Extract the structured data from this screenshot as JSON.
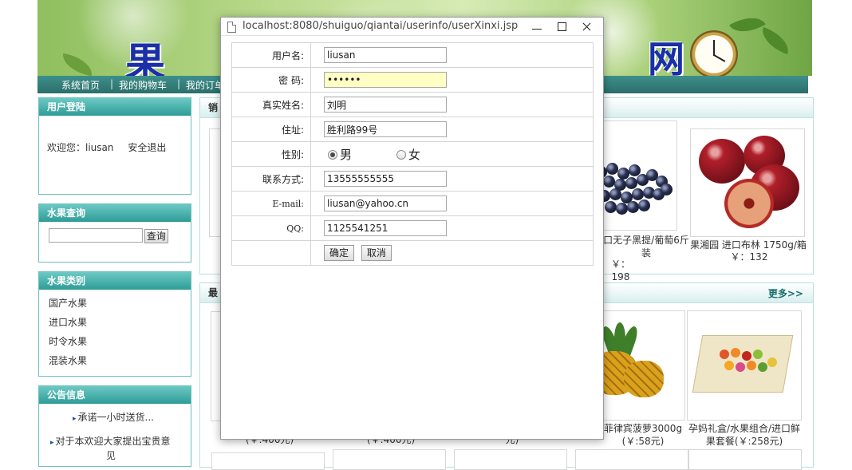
{
  "site": {
    "banner_title_left": "果 绿",
    "banner_title_right": "网",
    "nav": [
      "系统首页",
      "我的购物车",
      "我的订单"
    ]
  },
  "login_panel": {
    "title": "用户登陆",
    "welcome": "欢迎您：",
    "username": "liusan",
    "logout": "安全退出"
  },
  "search_panel": {
    "title": "水果查询",
    "input_value": "",
    "button": "查询"
  },
  "category_panel": {
    "title": "水果类别",
    "items": [
      "国产水果",
      "进口水果",
      "时令水果",
      "混装水果"
    ]
  },
  "notice_panel": {
    "title": "公告信息",
    "items": [
      "承诺一小时送货...",
      "对于本欢迎大家提出宝贵意",
      "见"
    ]
  },
  "hot_section": {
    "title_fragment": "销",
    "products": [
      {
        "name_line1": "口无子黑提/葡萄6斤",
        "name_line2": "装",
        "price": "￥：198"
      },
      {
        "name_line1": "果湘园 进口布林 1750g/箱",
        "price": "￥：132"
      }
    ]
  },
  "new_section": {
    "title_fragment": "最",
    "more": "更多>>",
    "products": [
      {
        "name_line1": "菲律宾菠萝3000g",
        "name_line2": "(￥:58元)"
      },
      {
        "name_line1": "孕妈礼盒/水果组合/进口鲜",
        "name_line2": "果套餐(￥:258元)"
      }
    ],
    "partial_prices": [
      "(￥:400元)",
      "(￥:400元)",
      "元)"
    ]
  },
  "popup": {
    "url": "localhost:8080/shuiguo/qiantai/userinfo/userXinxi.jsp",
    "fields": {
      "username_label": "用户名:",
      "username_value": "liusan",
      "password_label": "密 码:",
      "password_value": "••••••",
      "realname_label": "真实姓名:",
      "realname_value": "刘明",
      "address_label": "住址:",
      "address_value": "胜利路99号",
      "gender_label": "性别:",
      "gender_male": "男",
      "gender_female": "女",
      "gender_selected": "男",
      "phone_label": "联系方式:",
      "phone_value": "13555555555",
      "email_label": "E-mail:",
      "email_value": "liusan@yahoo.cn",
      "qq_label": "QQ:",
      "qq_value": "1125541251"
    },
    "confirm_button": "确定",
    "cancel_button": "取消"
  }
}
